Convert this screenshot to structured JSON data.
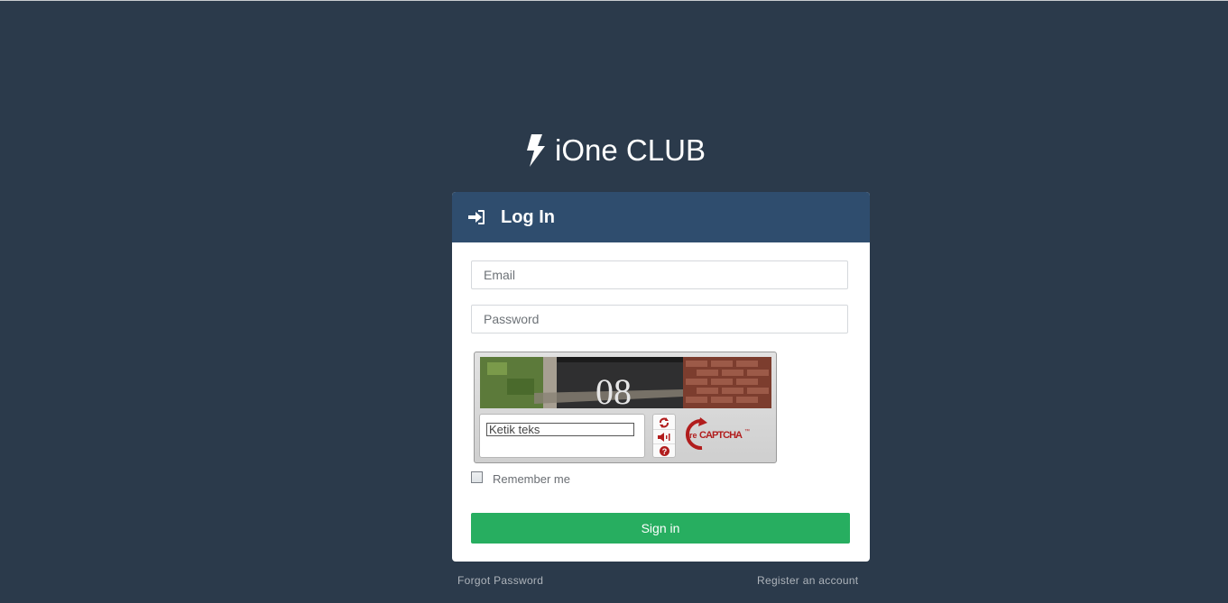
{
  "brand": {
    "name": "iOne CLUB",
    "icon": "bolt-icon"
  },
  "panel": {
    "title": "Log In",
    "title_icon": "sign-in-icon"
  },
  "form": {
    "email_placeholder": "Email",
    "email_value": "",
    "password_placeholder": "Password",
    "password_value": "",
    "captcha": {
      "input_placeholder": "Ketik teks",
      "input_value": "",
      "image_text": "08",
      "buttons": [
        "refresh-icon",
        "audio-icon",
        "help-icon"
      ],
      "logo_text_prefix": "re",
      "logo_text": "CAPTCHA",
      "logo_tm": "™"
    },
    "remember_label": "Remember me",
    "remember_checked": false,
    "signin_label": "Sign in"
  },
  "links": {
    "forgot": "Forgot Password",
    "register": "Register an account"
  },
  "colors": {
    "background": "#2b3a4b",
    "panel_header": "#2f4d6e",
    "signin_button": "#27ae60",
    "captcha_accent": "#b11d1d"
  }
}
